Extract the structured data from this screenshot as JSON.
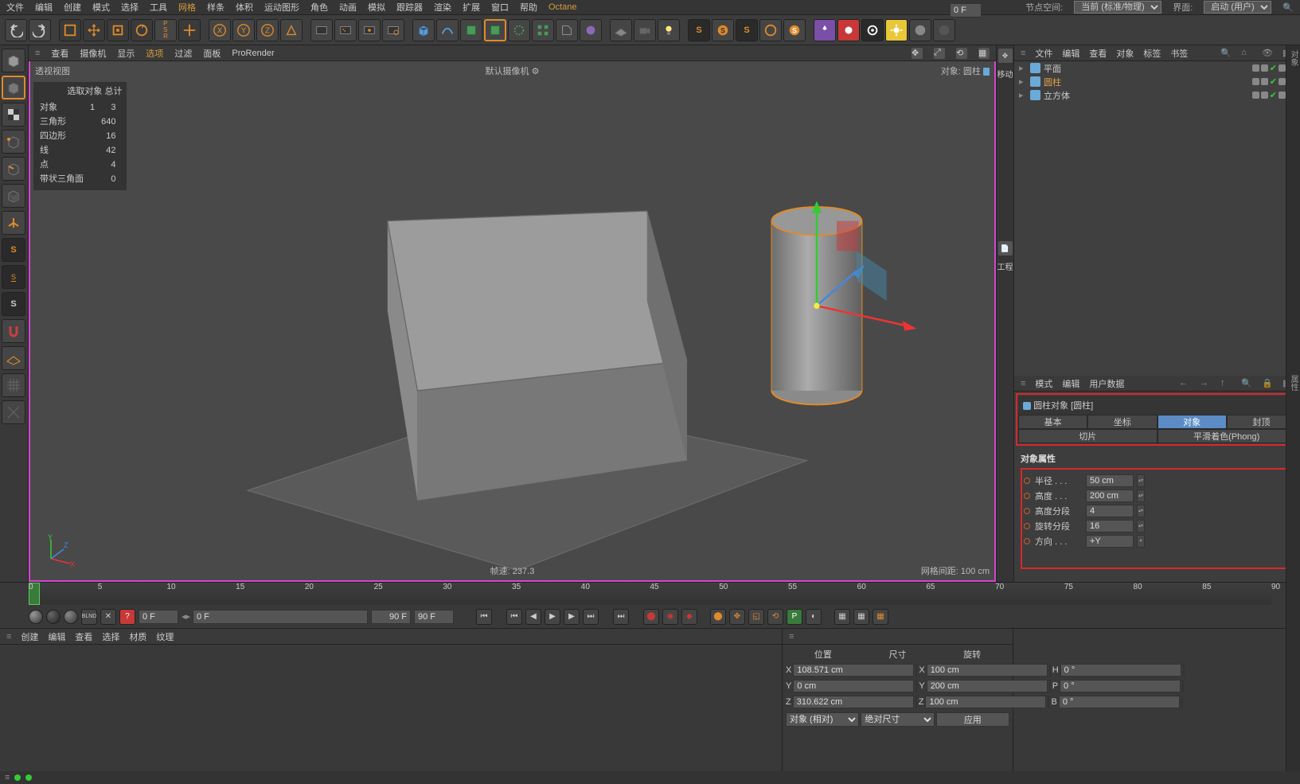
{
  "menubar": {
    "items": [
      "文件",
      "编辑",
      "创建",
      "模式",
      "选择",
      "工具",
      "网格",
      "样条",
      "体积",
      "运动图形",
      "角色",
      "动画",
      "模拟",
      "跟踪器",
      "渲染",
      "扩展",
      "窗口",
      "帮助",
      "Octane"
    ],
    "node_space_label": "节点空间:",
    "node_space_value": "当前 (标准/物理)",
    "layout_label": "界面:",
    "layout_value": "启动 (用户)"
  },
  "viewport_menu": {
    "items": [
      "查看",
      "摄像机",
      "显示",
      "选项",
      "过滤",
      "面板",
      "ProRender"
    ]
  },
  "viewport": {
    "title": "透视视图",
    "camera": "默认摄像机",
    "object_label": "对象: 圆柱",
    "fps": "帧速: 237.3",
    "grid": "网格间距: 100 cm",
    "stats_header": "选取对象  总计",
    "stats": [
      {
        "label": "对象",
        "a": "1",
        "b": "3"
      },
      {
        "label": "三角形",
        "a": "",
        "b": "640"
      },
      {
        "label": "四边形",
        "a": "",
        "b": "16"
      },
      {
        "label": "线",
        "a": "",
        "b": "42"
      },
      {
        "label": "点",
        "a": "",
        "b": "4"
      },
      {
        "label": "带状三角面",
        "a": "",
        "b": "0"
      }
    ]
  },
  "dock": {
    "move": "移动",
    "project": "工程"
  },
  "objmgr": {
    "menu": [
      "文件",
      "编辑",
      "查看",
      "对象",
      "标签",
      "书签"
    ],
    "rows": [
      {
        "name": "平面",
        "icon": "#6aa9d8",
        "sel": false
      },
      {
        "name": "圆柱",
        "icon": "#6aa9d8",
        "sel": true
      },
      {
        "name": "立方体",
        "icon": "#6aa9d8",
        "sel": false
      }
    ]
  },
  "attr": {
    "menu": [
      "模式",
      "编辑",
      "用户数据"
    ],
    "header": "圆柱对象 [圆柱]",
    "tabs1": [
      "基本",
      "坐标",
      "对象",
      "封顶"
    ],
    "tabs2": [
      "切片",
      "平滑着色(Phong)"
    ],
    "active_tab": "对象",
    "group": "对象属性",
    "rows": [
      {
        "label": "半径 . . .",
        "value": "50 cm",
        "spin": true
      },
      {
        "label": "高度 . . .",
        "value": "200 cm",
        "spin": true
      },
      {
        "label": "高度分段",
        "value": "4",
        "spin": true
      },
      {
        "label": "旋转分段",
        "value": "16",
        "spin": true
      },
      {
        "label": "方向 . . .",
        "value": "+Y",
        "spin": false
      }
    ]
  },
  "timeline": {
    "ticks": [
      "0",
      "5",
      "10",
      "15",
      "20",
      "25",
      "30",
      "35",
      "40",
      "45",
      "50",
      "55",
      "60",
      "65",
      "70",
      "75",
      "80",
      "85",
      "90"
    ],
    "frame_a": "0 F",
    "frame_b": "0 F",
    "frame_c": "90 F",
    "frame_d": "90 F",
    "frame_end": "0 F"
  },
  "matmenu": {
    "items": [
      "创建",
      "编辑",
      "查看",
      "选择",
      "材质",
      "纹理"
    ]
  },
  "coord": {
    "headers": [
      "位置",
      "尺寸",
      "旋转"
    ],
    "rows": [
      {
        "axis": "X",
        "p": "108.571 cm",
        "s": "100 cm",
        "rlabel": "H",
        "r": "0 °"
      },
      {
        "axis": "Y",
        "p": "0 cm",
        "s": "200 cm",
        "rlabel": "P",
        "r": "0 °"
      },
      {
        "axis": "Z",
        "p": "310.622 cm",
        "s": "100 cm",
        "rlabel": "B",
        "r": "0 °"
      }
    ],
    "mode1": "对象 (相对)",
    "mode2": "绝对尺寸",
    "apply": "应用"
  }
}
